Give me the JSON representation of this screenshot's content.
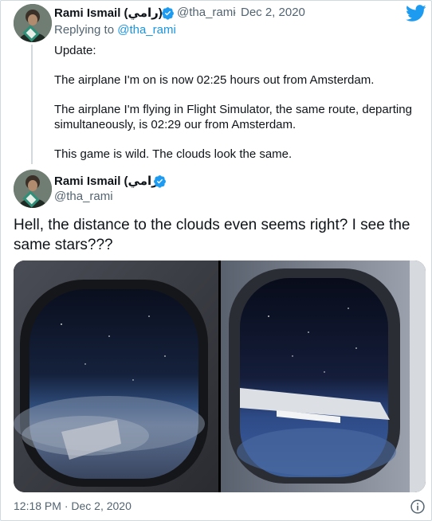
{
  "reply_tweet": {
    "display_name": "Rami Ismail (رامي)",
    "handle": "@tha_rami",
    "separator": "·",
    "date": "Dec 2, 2020",
    "replying_label": "Replying to",
    "replying_handle": "@tha_rami",
    "paragraphs": [
      "Update:",
      "The airplane I'm on is now 02:25 hours out from Amsterdam.",
      "The airplane I'm flying in Flight Simulator, the same route, departing simultaneously, is 02:29 our from Amsterdam.",
      "This game is wild. The clouds look the same."
    ]
  },
  "main_tweet": {
    "display_name": "Rami Ismail (رامي)",
    "handle": "@tha_rami",
    "text": "Hell, the distance to the clouds even seems right? I see the same stars???",
    "timestamp": "12:18 PM · Dec 2, 2020"
  },
  "icons": {
    "verified": "verified-badge-icon",
    "twitter": "twitter-bird-icon",
    "info": "info-icon"
  },
  "colors": {
    "brand": "#1d9bf0",
    "link": "#1b95e0",
    "muted": "#536471",
    "text": "#0f1419"
  }
}
